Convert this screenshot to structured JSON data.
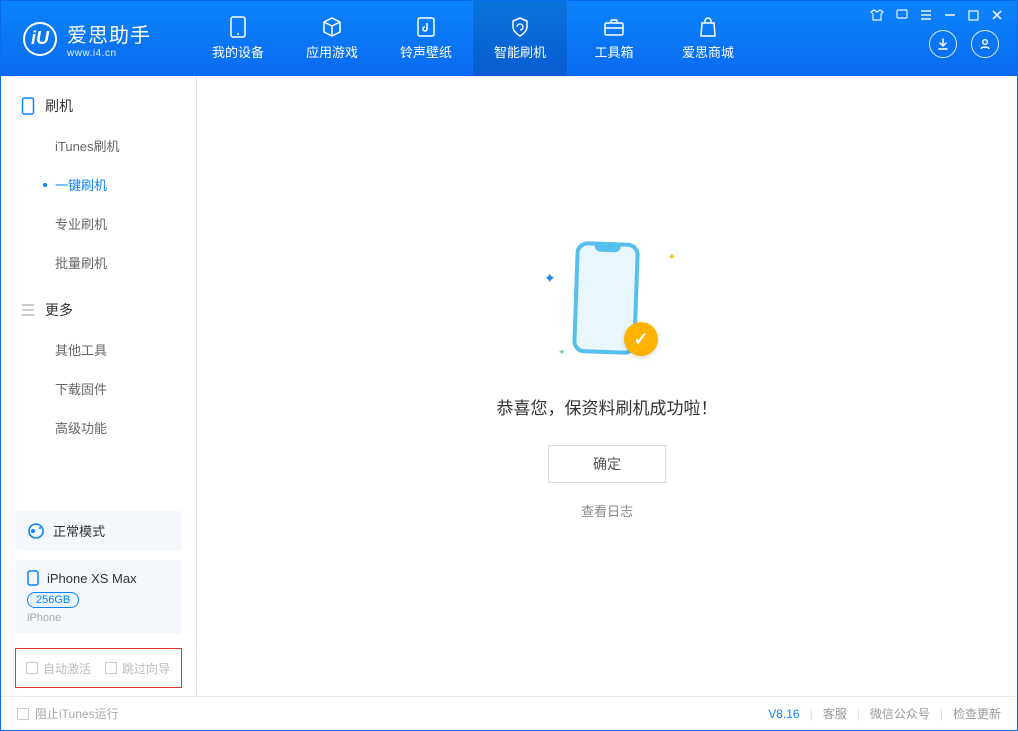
{
  "app": {
    "name_cn": "爱思助手",
    "name_en": "www.i4.cn",
    "version": "V8.16"
  },
  "nav": {
    "items": [
      {
        "label": "我的设备"
      },
      {
        "label": "应用游戏"
      },
      {
        "label": "铃声壁纸"
      },
      {
        "label": "智能刷机"
      },
      {
        "label": "工具箱"
      },
      {
        "label": "爱思商城"
      }
    ]
  },
  "sidebar": {
    "sections": [
      {
        "title": "刷机",
        "items": [
          {
            "label": "iTunes刷机"
          },
          {
            "label": "一键刷机"
          },
          {
            "label": "专业刷机"
          },
          {
            "label": "批量刷机"
          }
        ]
      },
      {
        "title": "更多",
        "items": [
          {
            "label": "其他工具"
          },
          {
            "label": "下载固件"
          },
          {
            "label": "高级功能"
          }
        ]
      }
    ],
    "mode": "正常模式",
    "device": {
      "name": "iPhone XS Max",
      "storage": "256GB",
      "type": "iPhone"
    },
    "options": {
      "auto_activate": "自动激活",
      "skip_guide": "跳过向导"
    }
  },
  "main": {
    "success_title": "恭喜您，保资料刷机成功啦！",
    "ok_btn": "确定",
    "view_log": "查看日志"
  },
  "footer": {
    "block_itunes": "阻止iTunes运行",
    "links": {
      "support": "客服",
      "wechat": "微信公众号",
      "update": "检查更新"
    }
  }
}
